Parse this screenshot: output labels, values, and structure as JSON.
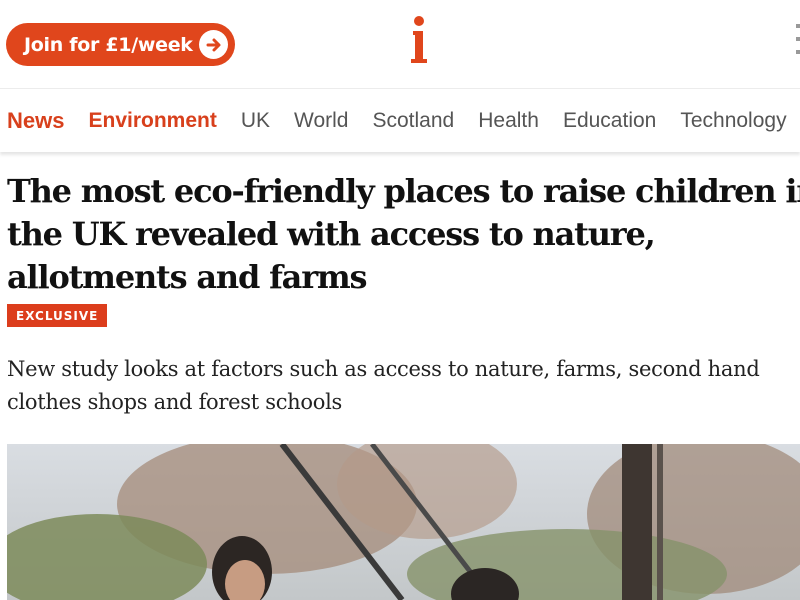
{
  "header": {
    "join_label": "Join for £1/week",
    "logo_letter": "i",
    "brand_color": "#e0461c"
  },
  "nav": {
    "items": [
      "News",
      "Environment",
      "UK",
      "World",
      "Scotland",
      "Health",
      "Education",
      "Technology"
    ]
  },
  "article": {
    "headline_lines": [
      "The most eco-friendly places to raise children in",
      "the UK revealed with access to nature,",
      "allotments and farms"
    ],
    "badge": "EXCLUSIVE",
    "standfirst_lines": [
      "New study looks at factors such as access to nature, farms, second hand",
      "clothes shops and forest schools"
    ]
  },
  "icons": {
    "join_arrow": "arrow-right-circle-icon",
    "menu": "menu-dots-icon"
  }
}
